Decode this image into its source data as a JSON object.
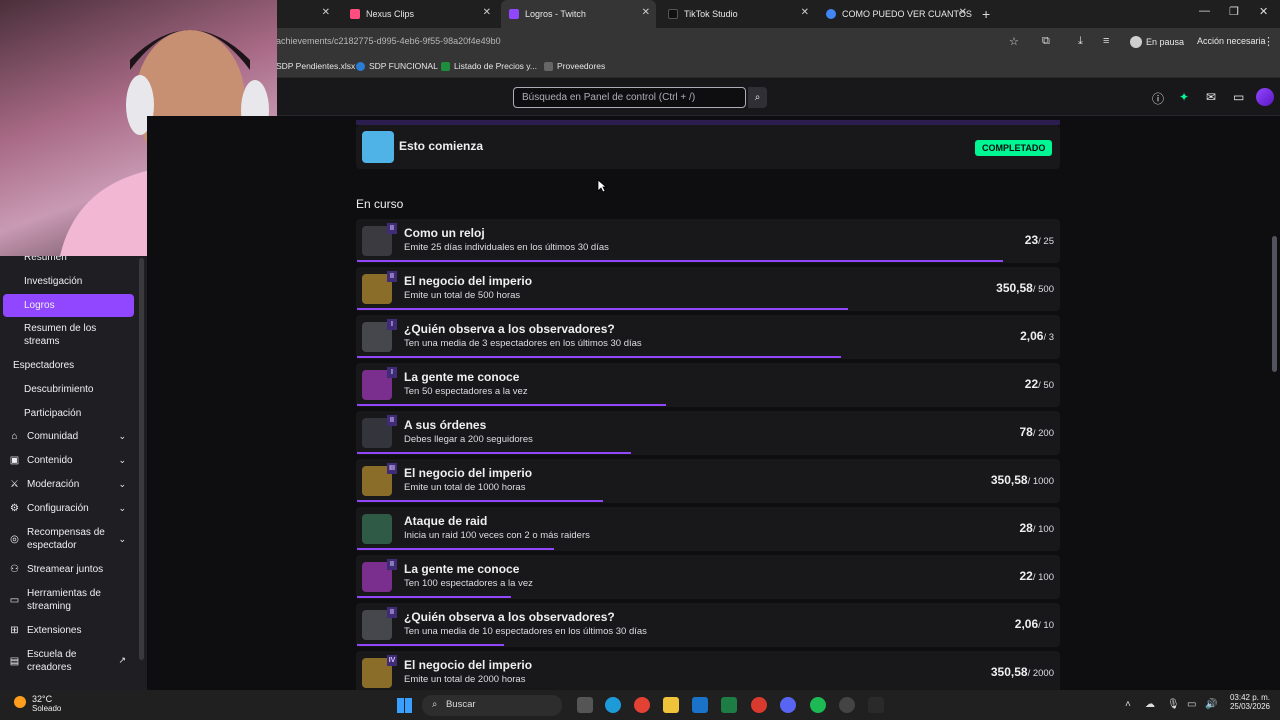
{
  "browser": {
    "tabs": [
      {
        "title": "Nexus Clips",
        "color": "#ff4d7e"
      },
      {
        "title": "Logros - Twitch",
        "color": "#9147ff"
      },
      {
        "title": "TikTok Studio",
        "color": "#000000"
      },
      {
        "title": "COMO PUEDO VER CUANTOS",
        "color": "#4285f4"
      }
    ],
    "url": "achievements/c2182775-d995-4eb6-9f55-98a20f4e49b0",
    "profile_status": "En pausa",
    "action_label": "Acción necesaria",
    "bookmarks": [
      "SDP Pendientes.xlsx",
      "SDP FUNCIONAL",
      "Listado de Precios y...",
      "Proveedores"
    ]
  },
  "twitch": {
    "search_placeholder": "Búsqueda en Panel de control (Ctrl + /)"
  },
  "sidebar": {
    "items": [
      {
        "label": "Resumen",
        "sub": true
      },
      {
        "label": "Investigación",
        "sub": true
      },
      {
        "label": "Logros",
        "sub": true,
        "active": true
      },
      {
        "label": "Resumen de los streams",
        "sub": true
      },
      {
        "label": "Espectadores",
        "sub": false
      },
      {
        "label": "Descubrimiento",
        "sub": true
      },
      {
        "label": "Participación",
        "sub": true
      },
      {
        "label": "Comunidad",
        "icon": "community-icon"
      },
      {
        "label": "Contenido",
        "icon": "content-icon"
      },
      {
        "label": "Moderación",
        "icon": "moderation-icon"
      },
      {
        "label": "Configuración",
        "icon": "settings-icon"
      },
      {
        "label": "Recompensas de espectador",
        "icon": "rewards-icon"
      },
      {
        "label": "Streamear juntos",
        "icon": "stream-together-icon"
      },
      {
        "label": "Herramientas de streaming",
        "icon": "tools-icon"
      },
      {
        "label": "Extensiones",
        "icon": "extensions-icon"
      },
      {
        "label": "Escuela de creadores",
        "icon": "school-icon"
      }
    ]
  },
  "main": {
    "completed_achievement": {
      "title": "Esto comienza",
      "status": "COMPLETADO"
    },
    "section_title": "En curso",
    "achievements": [
      {
        "title": "Como un reloj",
        "tier": "II",
        "desc": "Emite 25 días individuales en los últimos 30 días",
        "current": "23",
        "target": "/ 25",
        "progress": 0.92,
        "color": "#3a3a40"
      },
      {
        "title": "El negocio del imperio",
        "tier": "II",
        "desc": "Emite un total de 500 horas",
        "current": "350,58",
        "target": "/ 500",
        "progress": 0.7,
        "color": "#8a6d28"
      },
      {
        "title": "¿Quién observa a los observadores?",
        "tier": "I",
        "desc": "Ten una media de 3 espectadores en los últimos 30 días",
        "current": "2,06",
        "target": "/ 3",
        "progress": 0.69,
        "color": "#46464d"
      },
      {
        "title": "La gente me conoce",
        "tier": "I",
        "desc": "Ten 50 espectadores a la vez",
        "current": "22",
        "target": "/ 50",
        "progress": 0.44,
        "color": "#7a2f8f"
      },
      {
        "title": "A sus órdenes",
        "tier": "II",
        "desc": "Debes llegar a 200 seguidores",
        "current": "78",
        "target": "/ 200",
        "progress": 0.39,
        "color": "#34343c"
      },
      {
        "title": "El negocio del imperio",
        "tier": "III",
        "desc": "Emite un total de 1000 horas",
        "current": "350,58",
        "target": "/ 1000",
        "progress": 0.35,
        "color": "#8a6d28"
      },
      {
        "title": "Ataque de raid",
        "tier": "",
        "desc": "Inicia un raid 100 veces con 2 o más raiders",
        "current": "28",
        "target": "/ 100",
        "progress": 0.28,
        "color": "#2f5a45"
      },
      {
        "title": "La gente me conoce",
        "tier": "II",
        "desc": "Ten 100 espectadores a la vez",
        "current": "22",
        "target": "/ 100",
        "progress": 0.22,
        "color": "#7a2f8f"
      },
      {
        "title": "¿Quién observa a los observadores?",
        "tier": "II",
        "desc": "Ten una media de 10 espectadores en los últimos 30 días",
        "current": "2,06",
        "target": "/ 10",
        "progress": 0.21,
        "color": "#46464d"
      },
      {
        "title": "El negocio del imperio",
        "tier": "IV",
        "desc": "Emite un total de 2000 horas",
        "current": "350,58",
        "target": "/ 2000",
        "progress": 0.18,
        "color": "#8a6d28"
      }
    ]
  },
  "taskbar": {
    "temperature": "32°C",
    "weather": "Soleado",
    "search_label": "Buscar",
    "time": "03:42 p. m.",
    "date": "25/03/2026"
  }
}
